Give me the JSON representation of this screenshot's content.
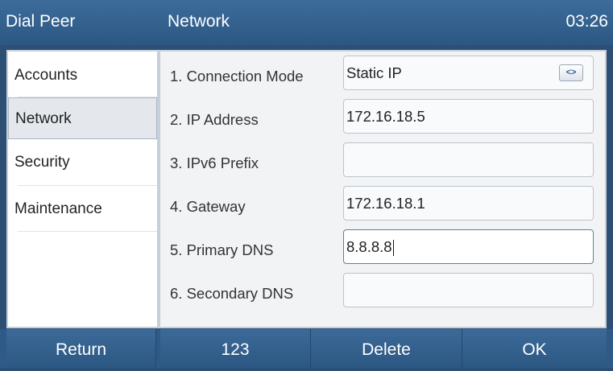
{
  "header": {
    "title_left": "Dial Peer",
    "title_center": "Network",
    "clock": "03:26"
  },
  "sidebar": {
    "items": [
      {
        "label": "Accounts",
        "selected": false
      },
      {
        "label": "Network",
        "selected": true
      },
      {
        "label": "Security",
        "selected": false
      },
      {
        "label": "Maintenance",
        "selected": false
      }
    ]
  },
  "form": {
    "rows": [
      {
        "label": "1. Connection Mode",
        "value": "Static IP",
        "control": "switch-icon"
      },
      {
        "label": "2. IP Address",
        "value": "172.16.18.5"
      },
      {
        "label": "3. IPv6 Prefix",
        "value": ""
      },
      {
        "label": "4. Gateway",
        "value": "172.16.18.1"
      },
      {
        "label": "5. Primary DNS",
        "value": "8.8.8.8",
        "focused": true
      },
      {
        "label": "6. Secondary DNS",
        "value": ""
      }
    ]
  },
  "softkeys": [
    "Return",
    "123",
    "Delete",
    "OK"
  ],
  "colors": {
    "header": "#2c5783",
    "softkey": "#2f5a88",
    "selected_item": "#e4e8ed"
  }
}
